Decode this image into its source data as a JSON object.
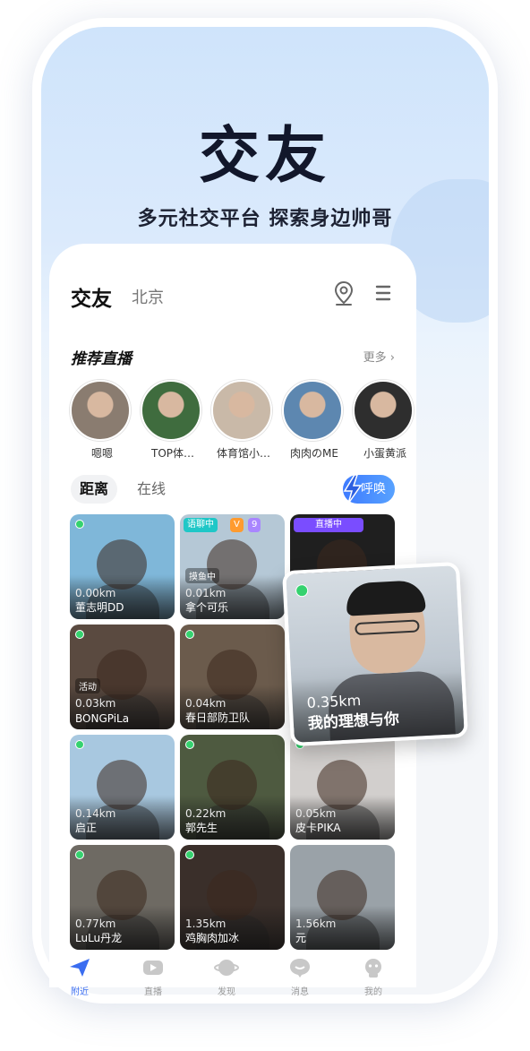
{
  "hero": {
    "title": "交友",
    "subtitle": "多元社交平台 探索身边帅哥"
  },
  "topbar": {
    "title": "交友",
    "city": "北京",
    "icons": [
      "location-pin-icon",
      "menu-icon"
    ]
  },
  "recommend": {
    "title": "推荐直播",
    "more": "更多 ›",
    "lives": [
      {
        "name": "嗯嗯",
        "color": "#8a7c70"
      },
      {
        "name": "TOP体…",
        "color": "#3f6c3e"
      },
      {
        "name": "体育馆小…",
        "color": "#c9b9a8"
      },
      {
        "name": "肉肉のME",
        "color": "#5d87b0"
      },
      {
        "name": "小蛋黄派",
        "color": "#2e2e2e"
      }
    ]
  },
  "filter": {
    "tab_distance": "距离",
    "tab_online": "在线",
    "call_button": "呼唤"
  },
  "tiles": [
    {
      "name": "董志明DD",
      "distance": "0.00km",
      "online": true,
      "bg": "#7fb7d9"
    },
    {
      "name": "拿个可乐",
      "distance": "0.01km",
      "online": false,
      "bg": "#b5c8d6",
      "tag": "语聊中",
      "tag_type": "voice",
      "vip": "V",
      "level": "9",
      "mini": "摸鱼中"
    },
    {
      "name": "",
      "distance": "",
      "online": false,
      "bg": "#1f1f1f",
      "tag": "直播中",
      "tag_type": "live"
    },
    {
      "name": "BONGPiLa",
      "distance": "0.03km",
      "online": true,
      "bg": "#5a4a40",
      "mini": "活动"
    },
    {
      "name": "春日部防卫队",
      "distance": "0.04km",
      "online": true,
      "bg": "#6b5b4c"
    },
    {
      "name": "",
      "distance": "",
      "online": false,
      "bg": "#cfd6dc"
    },
    {
      "name": "启正",
      "distance": "0.14km",
      "online": true,
      "bg": "#a8c8e0"
    },
    {
      "name": "郭先生",
      "distance": "0.22km",
      "online": true,
      "bg": "#4e5a40"
    },
    {
      "name": "皮卡PIKA",
      "distance": "0.05km",
      "online": true,
      "bg": "#d2cfcd"
    },
    {
      "name": "LuLu丹龙",
      "distance": "0.77km",
      "online": true,
      "bg": "#6e6a63"
    },
    {
      "name": "鸡胸肉加冰",
      "distance": "1.35km",
      "online": true,
      "bg": "#3a2f2a"
    },
    {
      "name": "元",
      "distance": "1.56km",
      "online": false,
      "bg": "#9aa2a8"
    }
  ],
  "popup": {
    "distance": "0.35km",
    "name": "我的理想与你",
    "online": true
  },
  "nav": [
    {
      "label": "附近",
      "icon": "send-icon",
      "active": true
    },
    {
      "label": "直播",
      "icon": "video-icon",
      "active": false
    },
    {
      "label": "发现",
      "icon": "planet-icon",
      "active": false
    },
    {
      "label": "消息",
      "icon": "chat-icon",
      "active": false
    },
    {
      "label": "我的",
      "icon": "profile-icon",
      "active": false
    }
  ],
  "colors": {
    "accent": "#3e7bff",
    "online": "#35d26f",
    "text": "#12172b"
  }
}
